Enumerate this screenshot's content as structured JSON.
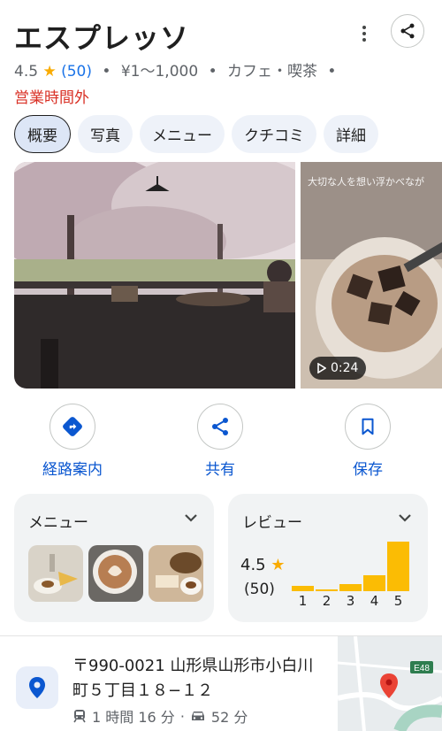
{
  "place": {
    "name": "エスプレッソ",
    "rating": "4.5",
    "review_count": "(50)",
    "price": "¥1～1,000",
    "category": "カフェ・喫茶",
    "status": "営業時間外"
  },
  "tabs": [
    {
      "label": "概要",
      "active": true
    },
    {
      "label": "写真"
    },
    {
      "label": "メニュー"
    },
    {
      "label": "クチコミ"
    },
    {
      "label": "詳細"
    }
  ],
  "media": {
    "video_duration": "0:24",
    "overlay_text": "大切な人を想い浮かべなが"
  },
  "actions": {
    "directions": "経路案内",
    "share": "共有",
    "save": "保存"
  },
  "menu_card": {
    "title": "メニュー"
  },
  "review_card": {
    "title": "レビュー",
    "rating": "4.5",
    "count": "(50)",
    "distribution": [
      {
        "star": "1",
        "value": 0.1
      },
      {
        "star": "2",
        "value": 0.03
      },
      {
        "star": "3",
        "value": 0.14
      },
      {
        "star": "4",
        "value": 0.33
      },
      {
        "star": "5",
        "value": 1.0
      }
    ]
  },
  "address": {
    "text": "〒990-0021 山形県山形市小白川町５丁目１８−１２",
    "transit_time": "1 時間 16 分",
    "drive_time": "52 分",
    "map_road_label": "E48"
  },
  "colors": {
    "accent": "#0b57d0",
    "star": "#f9ab00",
    "bar": "#fbbc04",
    "closed": "#d93025"
  }
}
